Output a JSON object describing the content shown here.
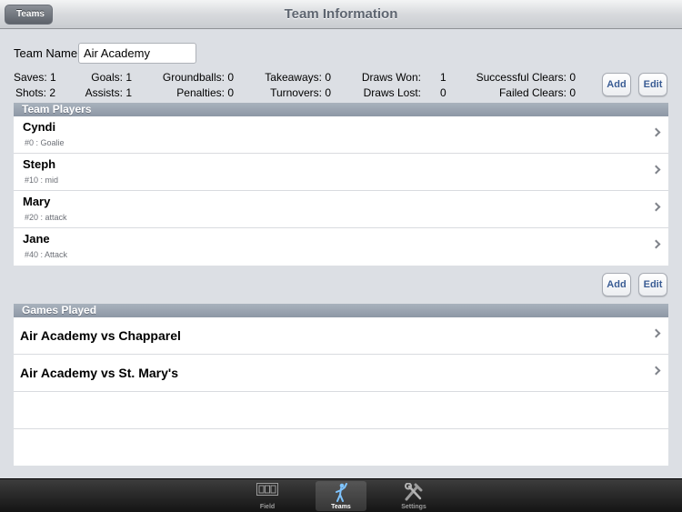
{
  "nav": {
    "back_label": "Teams",
    "title": "Team Information"
  },
  "team": {
    "name_label": "Team Name",
    "name_value": "Air Academy"
  },
  "stats": {
    "saves_label": "Saves:",
    "saves_value": "1",
    "shots_label": "Shots:",
    "shots_value": "2",
    "goals_label": "Goals:",
    "goals_value": "1",
    "assists_label": "Assists:",
    "assists_value": "1",
    "groundballs_label": "Groundballs:",
    "groundballs_value": "0",
    "penalties_label": "Penalties:",
    "penalties_value": "0",
    "takeaways_label": "Takeaways:",
    "takeaways_value": "0",
    "turnovers_label": "Turnovers:",
    "turnovers_value": "0",
    "draws_won_label": "Draws Won:",
    "draws_won_value": "1",
    "draws_lost_label": "Draws Lost:",
    "draws_lost_value": "0",
    "successful_clears_label": "Successful Clears:",
    "successful_clears_value": "0",
    "failed_clears_label": "Failed Clears:",
    "failed_clears_value": "0"
  },
  "buttons": {
    "add": "Add",
    "edit": "Edit"
  },
  "players_section": {
    "header": "Team Players",
    "players": [
      {
        "name": "Cyndi",
        "detail": "#0 : Goalie"
      },
      {
        "name": "Steph",
        "detail": "#10 : mid"
      },
      {
        "name": "Mary",
        "detail": "#20 : attack"
      },
      {
        "name": "Jane",
        "detail": "#40 : Attack"
      }
    ]
  },
  "games_section": {
    "header": "Games Played",
    "games": [
      {
        "title": "Air Academy vs Chapparel"
      },
      {
        "title": "Air Academy vs St. Mary's"
      }
    ]
  },
  "tabbar": {
    "tabs": [
      {
        "label": "Field",
        "icon": "scoreboard-icon"
      },
      {
        "label": "Teams",
        "icon": "lacrosse-player-icon"
      },
      {
        "label": "Settings",
        "icon": "tools-icon"
      }
    ],
    "active": "Teams"
  },
  "colors": {
    "accent": "#3a5c94",
    "section_header": "#96a0ad",
    "background": "#dcdfe4"
  }
}
